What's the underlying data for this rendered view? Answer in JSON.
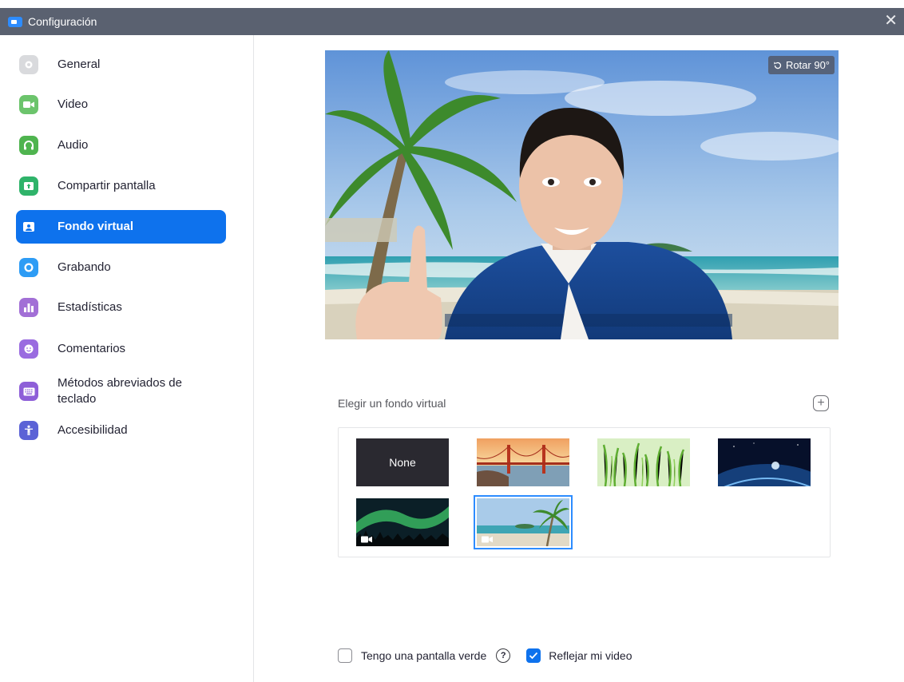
{
  "window": {
    "title": "Configuración",
    "close_glyph": "✕"
  },
  "sidebar": {
    "items": [
      {
        "label": "General",
        "icon": "gear-icon",
        "color": "#d9dadd"
      },
      {
        "label": "Video",
        "icon": "video-camera-icon",
        "color": "#6cc46c"
      },
      {
        "label": "Audio",
        "icon": "headphones-icon",
        "color": "#4fb44f"
      },
      {
        "label": "Compartir pantalla",
        "icon": "share-screen-icon",
        "color": "#2fb36a"
      },
      {
        "label": "Fondo virtual",
        "icon": "virtual-background-icon",
        "color": "#ffffff",
        "active": true
      },
      {
        "label": "Grabando",
        "icon": "record-icon",
        "color": "#2d9cf5"
      },
      {
        "label": "Estadísticas",
        "icon": "statistics-icon",
        "color": "#a26fd6"
      },
      {
        "label": "Comentarios",
        "icon": "feedback-smile-icon",
        "color": "#9a6be0"
      },
      {
        "label": "Métodos abreviados de teclado",
        "label_line1": "Métodos abreviados de",
        "label_line2": "teclado",
        "icon": "keyboard-icon",
        "color": "#8e5fd8"
      },
      {
        "label": "Accesibilidad",
        "icon": "accessibility-icon",
        "color": "#5b62d6"
      }
    ]
  },
  "preview": {
    "rotate_label": "Rotar 90°"
  },
  "backgrounds": {
    "title": "Elegir un fondo virtual",
    "add_glyph": "+",
    "none_label": "None",
    "items": [
      "none",
      "golden-gate-bridge",
      "green-grass",
      "earth-from-space",
      "northern-lights",
      "tropical-beach"
    ],
    "selected": "tropical-beach"
  },
  "options": {
    "green_screen": {
      "label": "Tengo una pantalla verde",
      "checked": false
    },
    "help_glyph": "?",
    "mirror_video": {
      "label": "Reflejar mi video",
      "checked": true
    }
  },
  "colors": {
    "accent": "#0e72ed",
    "titlebar": "#5a6170",
    "selection": "#2d8cff"
  }
}
